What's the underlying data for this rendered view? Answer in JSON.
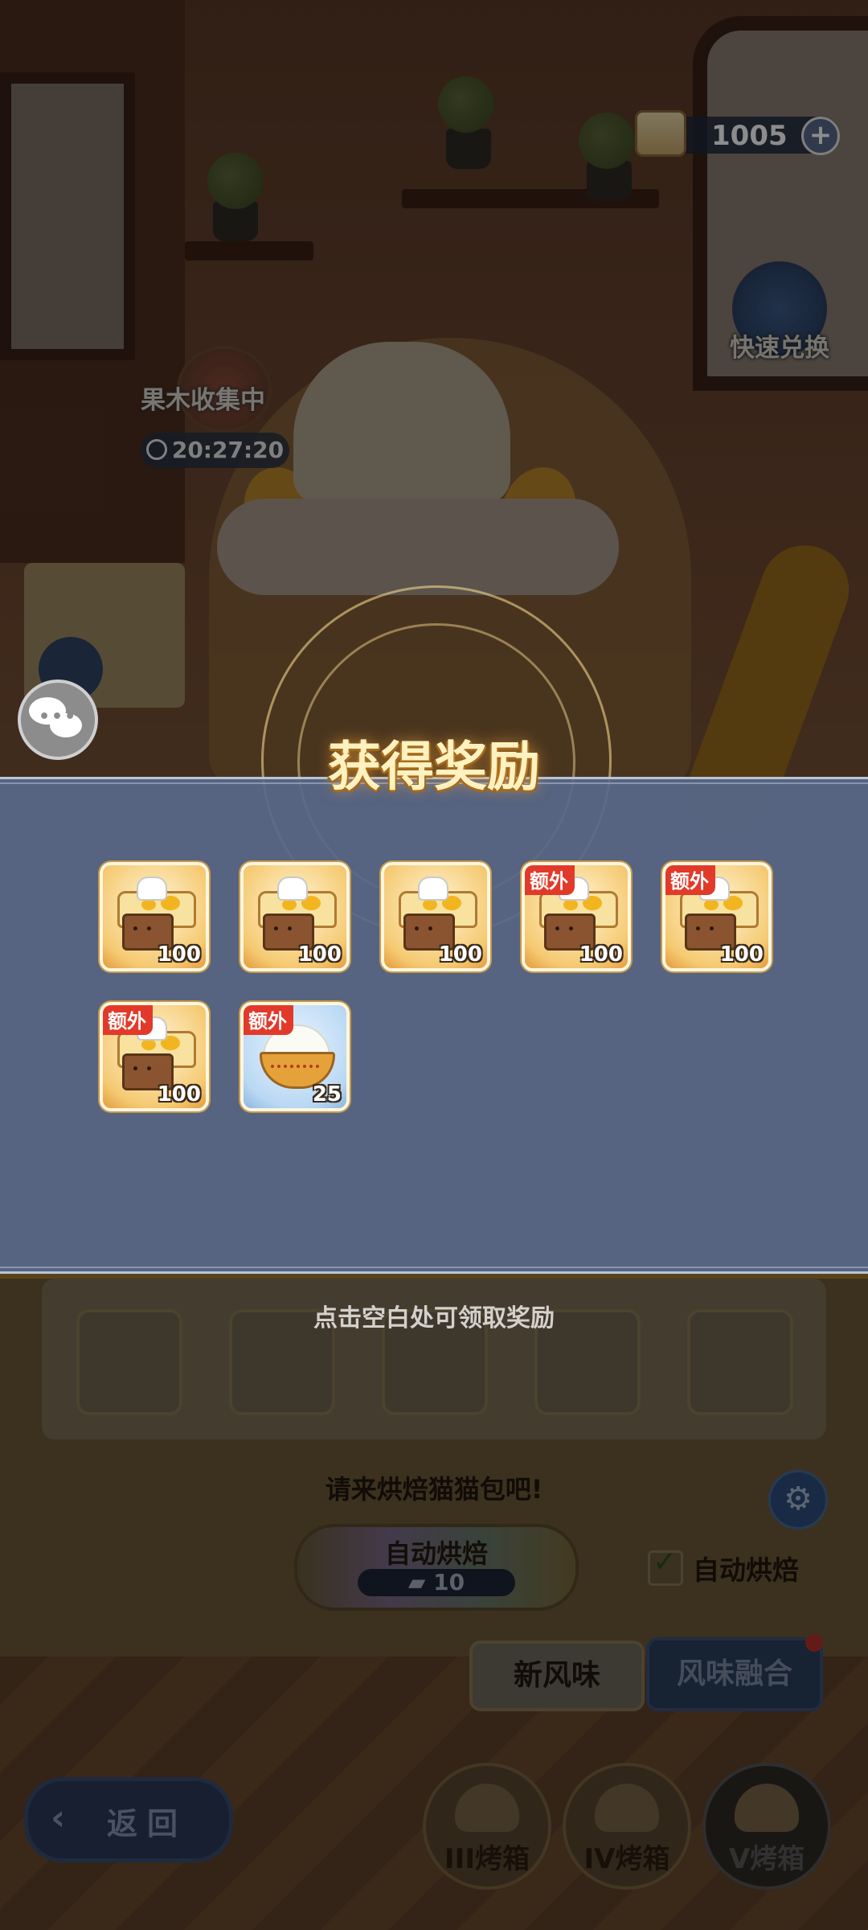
{
  "hud": {
    "currency_value": "1005",
    "currency_plus": "+",
    "quick_exchange_label": "快速兑换",
    "collect_label": "果木收集中",
    "collect_timer": "20:27:20"
  },
  "modal": {
    "title": "获得奖励",
    "claim_hint": "点击空白处可领取奖励",
    "rewards": [
      {
        "icon": "cat-bread-icon",
        "qty": "100",
        "tag": ""
      },
      {
        "icon": "cat-bread-icon",
        "qty": "100",
        "tag": ""
      },
      {
        "icon": "cat-bread-icon",
        "qty": "100",
        "tag": ""
      },
      {
        "icon": "cat-bread-icon",
        "qty": "100",
        "tag": "额外"
      },
      {
        "icon": "cat-bread-icon",
        "qty": "100",
        "tag": "额外"
      },
      {
        "icon": "cat-bread-icon",
        "qty": "100",
        "tag": "额外"
      },
      {
        "icon": "rice-bowl-icon",
        "qty": "25",
        "tag": "额外"
      }
    ]
  },
  "bake_panel": {
    "prompt": "请来烘焙猫猫包吧!",
    "auto_bake_label": "自动烘焙",
    "auto_bake_cost": "10",
    "auto_bake_check_label": "自动烘焙",
    "auto_bake_checked": true
  },
  "tabs": {
    "new_flavor": "新风味",
    "flavor_fusion": "风味融合"
  },
  "nav": {
    "back_label": "返回",
    "ovens": [
      "III烤箱",
      "IV烤箱",
      "V烤箱"
    ]
  },
  "colors": {
    "extra_tag": "#e23a2a",
    "band": "#58688a",
    "title_glow": "#fff2c0"
  }
}
